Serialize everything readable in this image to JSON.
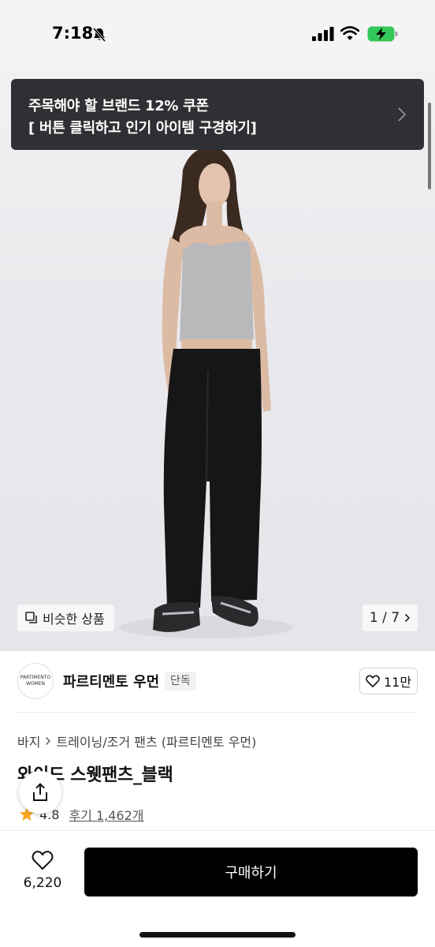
{
  "status_bar": {
    "time": "7:18"
  },
  "promo": {
    "line1": "주목해야 할 브랜드 12% 쿠폰",
    "line2": "[ 버튼 클릭하고 인기 아이템 구경하기]"
  },
  "gallery": {
    "similar_label": "비슷한 상품",
    "page_indicator": "1 / 7"
  },
  "brand": {
    "logo_line1": "PARTIMENTO",
    "logo_line2": "WOMEN",
    "name": "파르티멘토 우먼",
    "badge": "단독",
    "likes": "11만"
  },
  "product": {
    "breadcrumb": [
      "바지",
      "트레이닝/조거 팬츠 (파르티멘토 우먼)"
    ],
    "title": "와이드 스웻팬츠_블랙",
    "rating": "4.8",
    "reviews": "후기 1,462개"
  },
  "bottom_bar": {
    "wish_count": "6,220",
    "buy_label": "구매하기"
  },
  "colors": {
    "promo_bg": "#2f3033",
    "buy_bg": "#000000",
    "star": "#f5a623",
    "battery_green": "#34c759"
  },
  "icons": [
    "bell-slash-icon",
    "signal-icon",
    "wifi-icon",
    "battery-charging-icon",
    "chevron-right-icon",
    "similar-items-icon",
    "heart-icon",
    "share-icon",
    "star-icon"
  ]
}
